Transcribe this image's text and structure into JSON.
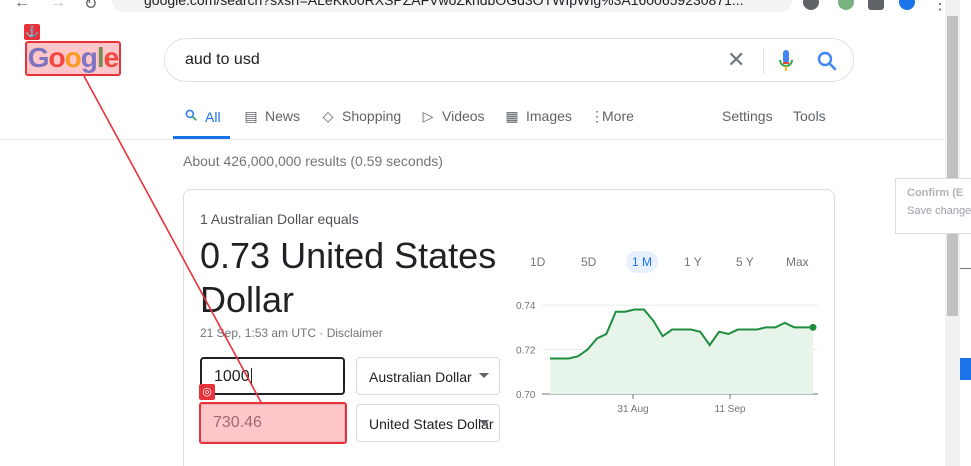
{
  "browser": {
    "url": "google.com/search?sxsrf=ALeKk00RXSPZAFVwoZkhdbOGd3OTWIpWlg%3A1600659230871..."
  },
  "logo": {
    "letters": [
      {
        "ch": "G",
        "color": "#4285f4"
      },
      {
        "ch": "o",
        "color": "#ea4335"
      },
      {
        "ch": "o",
        "color": "#fbbc05"
      },
      {
        "ch": "g",
        "color": "#4285f4"
      },
      {
        "ch": "l",
        "color": "#34a853"
      },
      {
        "ch": "e",
        "color": "#ea4335"
      }
    ]
  },
  "search": {
    "query": "aud to usd",
    "clear_icon": "close-icon",
    "voice_icon": "microphone-icon",
    "submit_icon": "search-icon"
  },
  "tabs": {
    "all": "All",
    "news": "News",
    "shopping": "Shopping",
    "videos": "Videos",
    "images": "Images",
    "more": "More",
    "settings": "Settings",
    "tools": "Tools"
  },
  "stats": "About 426,000,000 results (0.59 seconds)",
  "converter": {
    "equals_text": "1 Australian Dollar equals",
    "result": "0.73 United States Dollar",
    "meta": "21 Sep, 1:53 am UTC · Disclaimer",
    "amount": "1000",
    "converted": "730.46",
    "from_currency": "Australian Dollar",
    "to_currency": "United States Dollar"
  },
  "ranges": [
    "1D",
    "5D",
    "1 M",
    "1 Y",
    "5 Y",
    "Max"
  ],
  "active_range": "1 M",
  "side_panel": {
    "title": "Confirm (E",
    "subtitle": "Save change"
  },
  "chart_data": {
    "type": "area",
    "x_ticks": [
      "31 Aug",
      "11 Sep"
    ],
    "y_ticks": [
      0.7,
      0.72,
      0.74
    ],
    "ylim": [
      0.7,
      0.745
    ],
    "values": [
      0.716,
      0.716,
      0.716,
      0.717,
      0.72,
      0.725,
      0.727,
      0.737,
      0.737,
      0.738,
      0.738,
      0.733,
      0.726,
      0.729,
      0.729,
      0.729,
      0.728,
      0.722,
      0.728,
      0.727,
      0.729,
      0.729,
      0.729,
      0.73,
      0.73,
      0.732,
      0.73,
      0.73,
      0.73
    ],
    "line_color": "#1e8e3e",
    "fill_color": "#e6f4ea"
  },
  "annotations": {
    "color": "#e8323a",
    "source_icon": "anchor-icon",
    "target_icon": "target-icon"
  }
}
